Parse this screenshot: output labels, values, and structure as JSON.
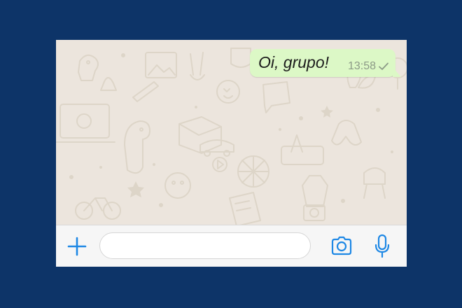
{
  "conversation": {
    "messages": [
      {
        "direction": "outgoing",
        "text": "Oi, grupo!",
        "time": "13:58",
        "status_icon": "single-check-icon"
      }
    ]
  },
  "composer": {
    "attach_icon": "plus-icon",
    "input_value": "",
    "camera_icon": "camera-icon",
    "mic_icon": "microphone-icon"
  },
  "colors": {
    "page_background": "#0d3468",
    "chat_wallpaper": "#ece5dd",
    "outgoing_bubble": "#dcf8c6",
    "accent": "#1e88e5"
  }
}
